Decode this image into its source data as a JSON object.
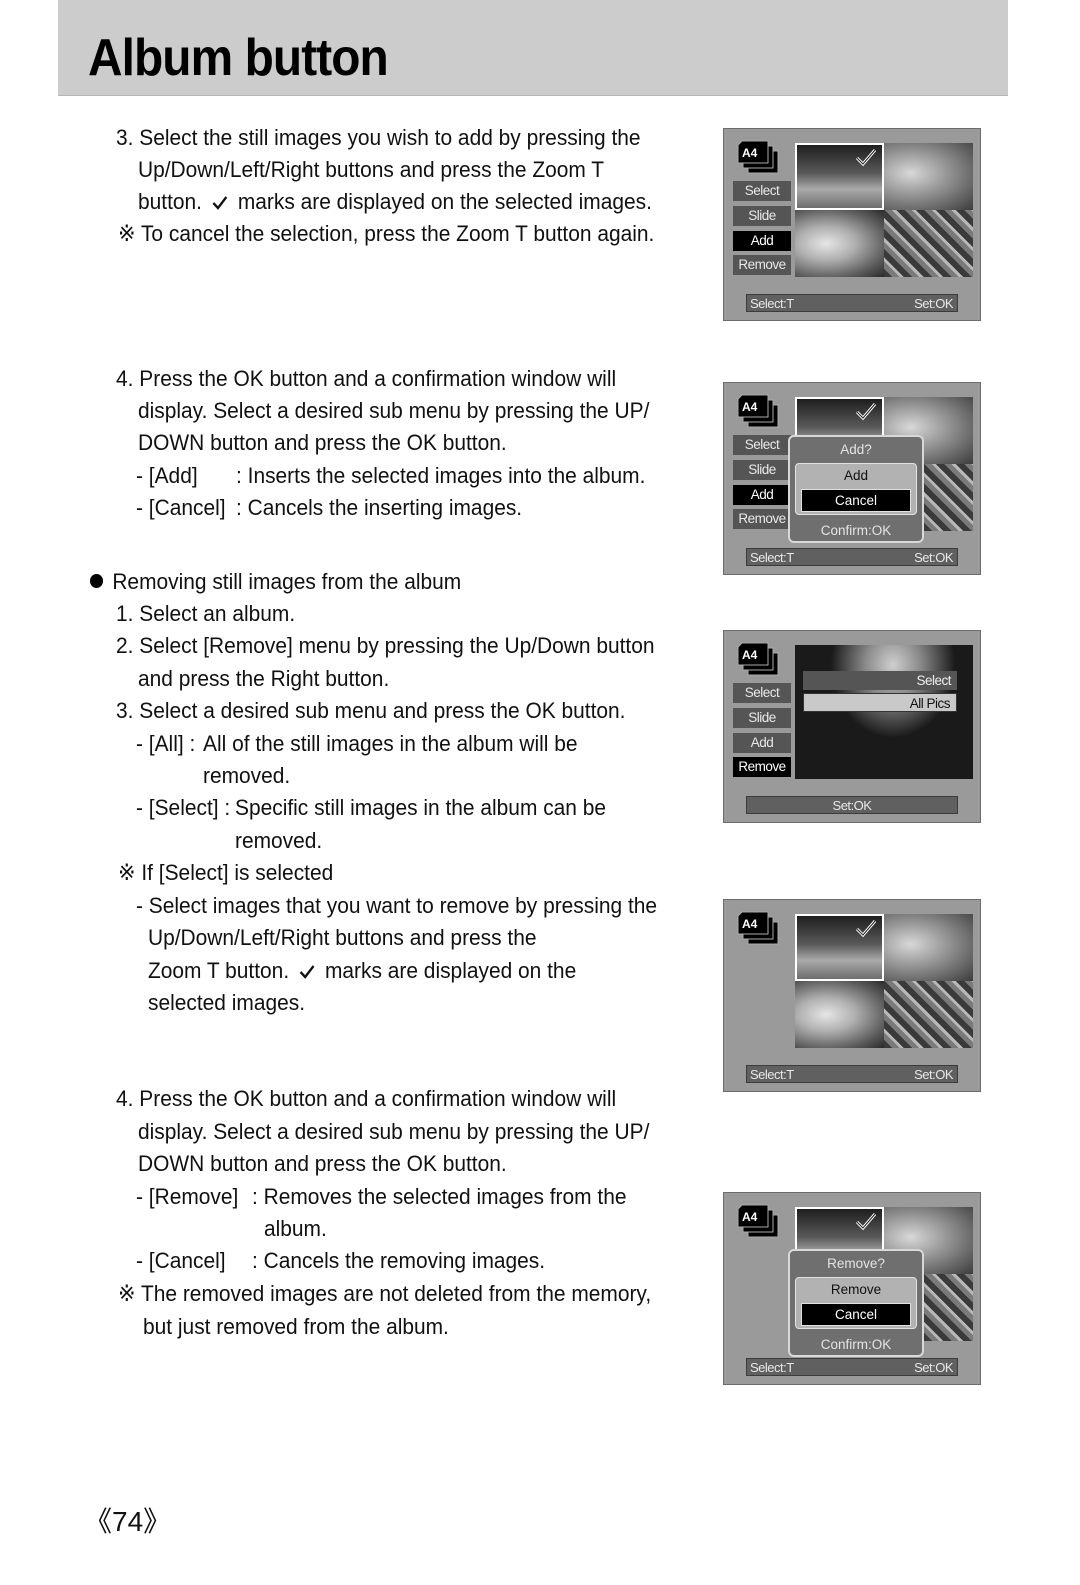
{
  "header": {
    "title": "Album button"
  },
  "left": {
    "step3_add": {
      "lines": [
        "3. Select the still images you wish to add by pressing the",
        "Up/Down/Left/Right buttons and press the Zoom T",
        "button.",
        "marks are displayed on the selected images."
      ],
      "note": "※ To cancel the selection, press the Zoom T button again."
    },
    "step4_add": {
      "lines": [
        "4. Press the OK button and a confirmation window will",
        "display. Select a desired sub menu by pressing the UP/",
        "DOWN button and press the OK button."
      ],
      "options": [
        {
          "key": "- [Add]",
          "desc": ": Inserts the selected images into the album."
        },
        {
          "key": "- [Cancel]",
          "desc": ": Cancels the inserting images."
        }
      ]
    },
    "remove_section": {
      "heading": "Removing still images from the album",
      "step1": "1. Select an album.",
      "step2": [
        "2. Select [Remove] menu by pressing the Up/Down button",
        "and press the Right button."
      ],
      "step3": "3. Select a desired sub menu and press the OK button.",
      "all_option": {
        "key": "- [All] :",
        "desc": "All of the still images in the album will be",
        "cont": "removed."
      },
      "select_option": {
        "key": "- [Select] :",
        "desc": "Specific still images in the album can be",
        "cont": "removed."
      },
      "if_select_note": "※ If [Select] is selected",
      "if_select_lines": [
        "- Select images that you want to remove by pressing the",
        "Up/Down/Left/Right buttons and press the",
        "Zoom T button.",
        "marks are displayed on the",
        "selected images."
      ]
    },
    "step4_remove": {
      "lines": [
        "4. Press the OK button and a confirmation window will",
        "display. Select a desired sub menu by pressing the UP/",
        "DOWN button and press the OK button."
      ],
      "options": [
        {
          "key": "- [Remove]",
          "desc": ": Removes the selected images from the",
          "cont": "album."
        },
        {
          "key": "- [Cancel]",
          "desc": ": Cancels the removing images."
        }
      ],
      "note": [
        "※ The removed images are not deleted from the memory,",
        "but just removed from the album."
      ]
    }
  },
  "screens": {
    "album_badge": "A4",
    "menu": [
      "Select",
      "Slide",
      "Add",
      "Remove"
    ],
    "status_left": "Select:T",
    "status_right": "Set:OK",
    "screen1": {
      "active_menu": "Add"
    },
    "screen2": {
      "active_menu": "Add",
      "dialog": {
        "question": "Add?",
        "option1": "Add",
        "option2": "Cancel",
        "confirm": "Confirm:OK"
      }
    },
    "screen3": {
      "active_menu": "Remove",
      "submenu": [
        "Select",
        "All Pics"
      ],
      "status_center": "Set:OK"
    },
    "screen5": {
      "dialog": {
        "question": "Remove?",
        "option1": "Remove",
        "option2": "Cancel",
        "confirm": "Confirm:OK"
      }
    }
  },
  "footer": {
    "page_number": "《74》"
  }
}
